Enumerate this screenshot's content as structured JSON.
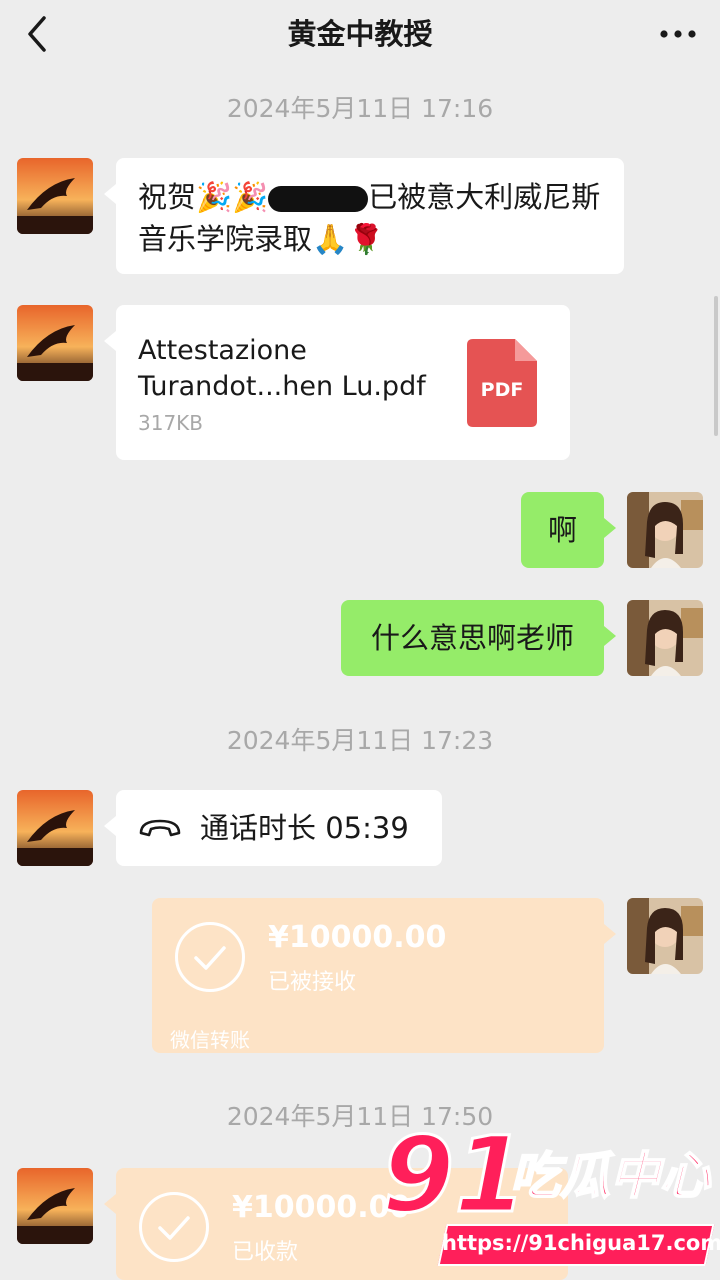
{
  "header": {
    "title": "黄金中教授"
  },
  "messages": {
    "time1": "2024年5月11日 17:16",
    "msg1_line1_a": "祝贺",
    "msg1_line1_b": "已被意大利威尼斯",
    "msg1_line2": "音乐学院录取",
    "file_name_line1": "Attestazione",
    "file_name_line2": "Turandot...hen Lu.pdf",
    "file_size": "317KB",
    "file_icon_label": "PDF",
    "reply1": "啊",
    "reply2": "什么意思啊老师",
    "time2": "2024年5月11日 17:23",
    "call_text": "通话时长 05:39",
    "transfer1_amount": "¥10000.00",
    "transfer1_status": "已被接收",
    "transfer1_foot": "微信转账",
    "time3": "2024年5月11日 17:50",
    "transfer2_amount": "¥10000.00",
    "transfer2_status": "已收款"
  },
  "watermark": {
    "big": "91",
    "text": "吃瓜中心",
    "url": "https://91chigua17.com"
  },
  "colors": {
    "background": "#ededed",
    "green_bubble": "#95ec69",
    "transfer": "#fde3c6",
    "pdf": "#e55353",
    "watermark": "#ff1f5a"
  }
}
